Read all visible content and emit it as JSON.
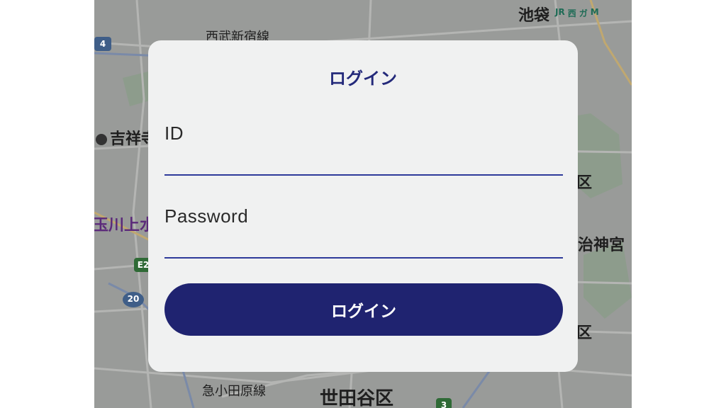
{
  "map": {
    "labels": {
      "ikebukuro": "池袋",
      "seibu_shinjuku": "西武新宿線",
      "kichijoji": "吉祥寺",
      "tamagawa_josui": "玉川上水",
      "meiji_jingu": "治神宮",
      "setagaya": "世田谷区",
      "odakyu": "急小田原線",
      "ku_upper": "区",
      "ku_lower": "区"
    },
    "station_icons": [
      "JR",
      "西",
      "ガ",
      "M"
    ],
    "route_shields": {
      "r4": "4",
      "e2": "E2",
      "r20": "20",
      "r3": "3"
    },
    "colors": {
      "map_base": "#9a9c9a",
      "shield_blue": "#3f5e88",
      "shield_green": "#2f6a36"
    }
  },
  "dialog": {
    "title": "ログイン",
    "id_label": "ID",
    "id_value": "",
    "password_label": "Password",
    "password_value": "",
    "submit_label": "ログイン",
    "colors": {
      "accent": "#1f2370",
      "title": "#23297a",
      "background": "#f0f1f1"
    }
  }
}
